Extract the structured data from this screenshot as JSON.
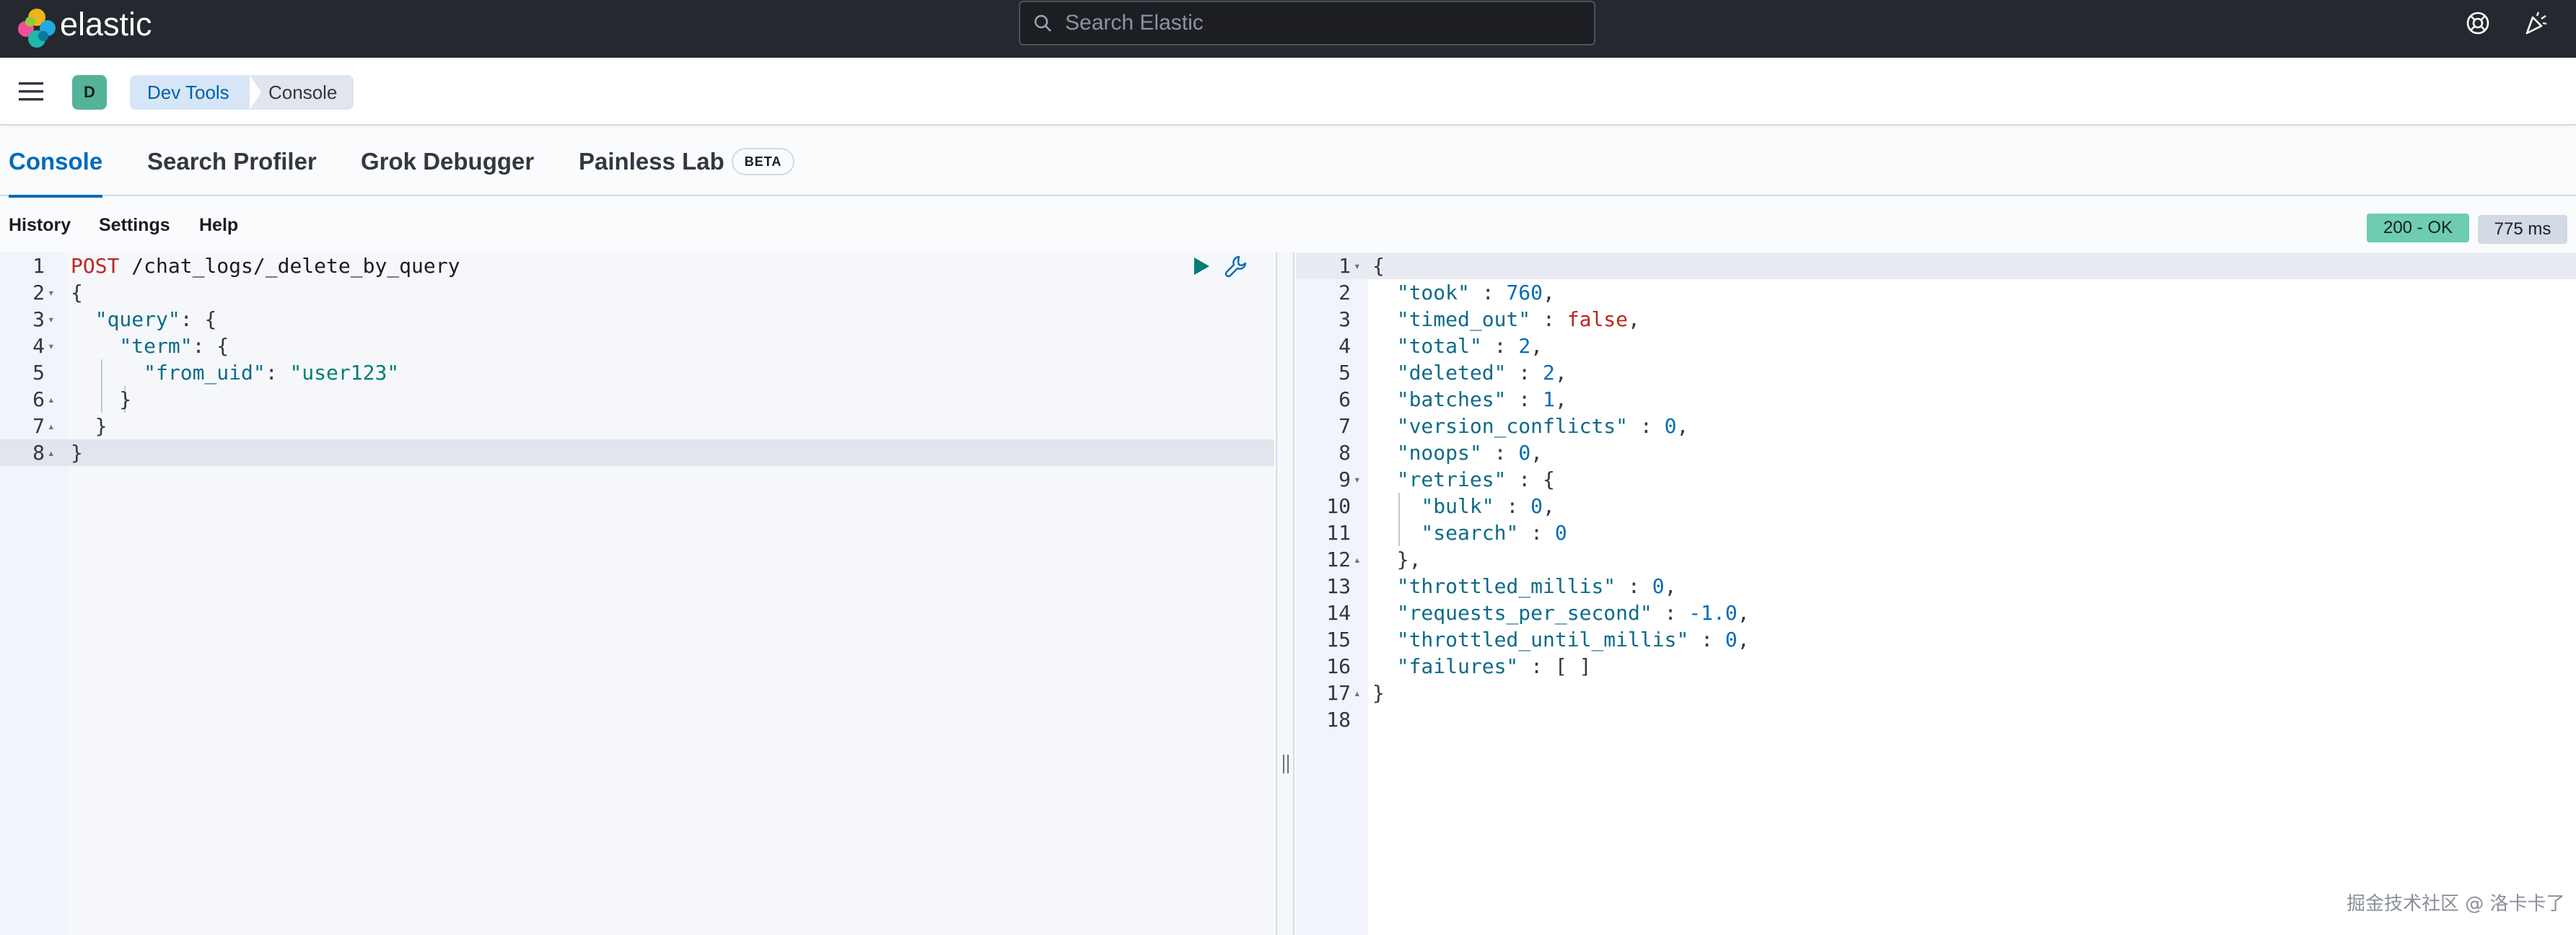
{
  "header": {
    "brand": "elastic",
    "search_placeholder": "Search Elastic"
  },
  "breadcrumbs": {
    "space_initial": "D",
    "items": [
      "Dev Tools",
      "Console"
    ]
  },
  "tabs": [
    {
      "label": "Console",
      "active": true
    },
    {
      "label": "Search Profiler",
      "active": false
    },
    {
      "label": "Grok Debugger",
      "active": false
    },
    {
      "label": "Painless Lab",
      "active": false,
      "badge": "BETA"
    }
  ],
  "toolbar": {
    "history": "History",
    "settings": "Settings",
    "help": "Help",
    "status": "200 - OK",
    "time": "775 ms"
  },
  "request_lines": [
    {
      "n": "1",
      "fold": "",
      "code": [
        [
          "POST",
          "k-method"
        ],
        [
          " /chat_logs/_delete_by_query",
          "k-path"
        ]
      ]
    },
    {
      "n": "2",
      "fold": "▾",
      "code": [
        [
          "{",
          "k-punct"
        ]
      ]
    },
    {
      "n": "3",
      "fold": "▾",
      "code": [
        [
          "  ",
          ""
        ],
        [
          "\"query\"",
          "k-key"
        ],
        [
          ": {",
          "k-punct"
        ]
      ]
    },
    {
      "n": "4",
      "fold": "▾",
      "code": [
        [
          "    ",
          ""
        ],
        [
          "\"term\"",
          "k-key"
        ],
        [
          ": {",
          "k-punct"
        ]
      ]
    },
    {
      "n": "5",
      "fold": "",
      "code": [
        [
          "      ",
          ""
        ],
        [
          "\"from_uid\"",
          "k-key"
        ],
        [
          ": ",
          "k-punct"
        ],
        [
          "\"user123\"",
          "k-str"
        ]
      ]
    },
    {
      "n": "6",
      "fold": "▴",
      "code": [
        [
          "    }",
          "k-punct"
        ]
      ]
    },
    {
      "n": "7",
      "fold": "▴",
      "code": [
        [
          "  }",
          "k-punct"
        ]
      ]
    },
    {
      "n": "8",
      "fold": "▴",
      "code": [
        [
          "}",
          "k-punct"
        ]
      ]
    }
  ],
  "response_lines": [
    {
      "n": "1",
      "fold": "▾",
      "code": [
        [
          "{",
          "k-punct"
        ]
      ]
    },
    {
      "n": "2",
      "fold": "",
      "code": [
        [
          "  ",
          ""
        ],
        [
          "\"took\"",
          "k-key"
        ],
        [
          " : ",
          "k-punct"
        ],
        [
          "760",
          "k-num"
        ],
        [
          ",",
          "k-punct"
        ]
      ]
    },
    {
      "n": "3",
      "fold": "",
      "code": [
        [
          "  ",
          ""
        ],
        [
          "\"timed_out\"",
          "k-key"
        ],
        [
          " : ",
          "k-punct"
        ],
        [
          "false",
          "k-bool"
        ],
        [
          ",",
          "k-punct"
        ]
      ]
    },
    {
      "n": "4",
      "fold": "",
      "code": [
        [
          "  ",
          ""
        ],
        [
          "\"total\"",
          "k-key"
        ],
        [
          " : ",
          "k-punct"
        ],
        [
          "2",
          "k-num"
        ],
        [
          ",",
          "k-punct"
        ]
      ]
    },
    {
      "n": "5",
      "fold": "",
      "code": [
        [
          "  ",
          ""
        ],
        [
          "\"deleted\"",
          "k-key"
        ],
        [
          " : ",
          "k-punct"
        ],
        [
          "2",
          "k-num"
        ],
        [
          ",",
          "k-punct"
        ]
      ]
    },
    {
      "n": "6",
      "fold": "",
      "code": [
        [
          "  ",
          ""
        ],
        [
          "\"batches\"",
          "k-key"
        ],
        [
          " : ",
          "k-punct"
        ],
        [
          "1",
          "k-num"
        ],
        [
          ",",
          "k-punct"
        ]
      ]
    },
    {
      "n": "7",
      "fold": "",
      "code": [
        [
          "  ",
          ""
        ],
        [
          "\"version_conflicts\"",
          "k-key"
        ],
        [
          " : ",
          "k-punct"
        ],
        [
          "0",
          "k-num"
        ],
        [
          ",",
          "k-punct"
        ]
      ]
    },
    {
      "n": "8",
      "fold": "",
      "code": [
        [
          "  ",
          ""
        ],
        [
          "\"noops\"",
          "k-key"
        ],
        [
          " : ",
          "k-punct"
        ],
        [
          "0",
          "k-num"
        ],
        [
          ",",
          "k-punct"
        ]
      ]
    },
    {
      "n": "9",
      "fold": "▾",
      "code": [
        [
          "  ",
          ""
        ],
        [
          "\"retries\"",
          "k-key"
        ],
        [
          " : {",
          "k-punct"
        ]
      ]
    },
    {
      "n": "10",
      "fold": "",
      "code": [
        [
          "    ",
          ""
        ],
        [
          "\"bulk\"",
          "k-key"
        ],
        [
          " : ",
          "k-punct"
        ],
        [
          "0",
          "k-num"
        ],
        [
          ",",
          "k-punct"
        ]
      ]
    },
    {
      "n": "11",
      "fold": "",
      "code": [
        [
          "    ",
          ""
        ],
        [
          "\"search\"",
          "k-key"
        ],
        [
          " : ",
          "k-punct"
        ],
        [
          "0",
          "k-num"
        ]
      ]
    },
    {
      "n": "12",
      "fold": "▴",
      "code": [
        [
          "  },",
          "k-punct"
        ]
      ]
    },
    {
      "n": "13",
      "fold": "",
      "code": [
        [
          "  ",
          ""
        ],
        [
          "\"throttled_millis\"",
          "k-key"
        ],
        [
          " : ",
          "k-punct"
        ],
        [
          "0",
          "k-num"
        ],
        [
          ",",
          "k-punct"
        ]
      ]
    },
    {
      "n": "14",
      "fold": "",
      "code": [
        [
          "  ",
          ""
        ],
        [
          "\"requests_per_second\"",
          "k-key"
        ],
        [
          " : ",
          "k-punct"
        ],
        [
          "-1.0",
          "k-num"
        ],
        [
          ",",
          "k-punct"
        ]
      ]
    },
    {
      "n": "15",
      "fold": "",
      "code": [
        [
          "  ",
          ""
        ],
        [
          "\"throttled_until_millis\"",
          "k-key"
        ],
        [
          " : ",
          "k-punct"
        ],
        [
          "0",
          "k-num"
        ],
        [
          ",",
          "k-punct"
        ]
      ]
    },
    {
      "n": "16",
      "fold": "",
      "code": [
        [
          "  ",
          ""
        ],
        [
          "\"failures\"",
          "k-key"
        ],
        [
          " : [ ]",
          "k-punct"
        ]
      ]
    },
    {
      "n": "17",
      "fold": "▴",
      "code": [
        [
          "}",
          "k-punct"
        ]
      ]
    },
    {
      "n": "18",
      "fold": "",
      "code": []
    }
  ],
  "watermark": "掘金技术社区 @ 洛卡卡了",
  "colors": {
    "header_bg": "#25282f",
    "accent": "#006bb8",
    "status_ok": "#6dccb1",
    "run_button": "#017d73"
  }
}
